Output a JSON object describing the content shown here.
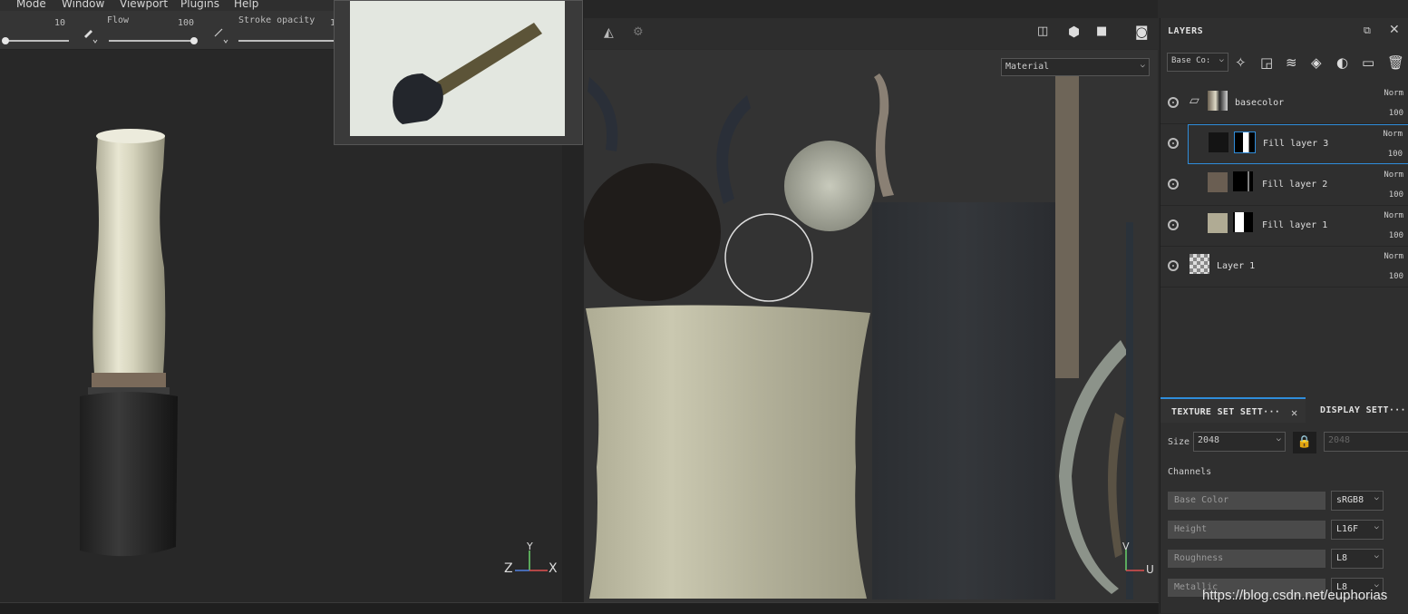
{
  "menubar": {
    "items": [
      "Mode",
      "Window",
      "Viewport",
      "Plugins",
      "Help"
    ]
  },
  "toolbar": {
    "size_value": "10",
    "flow_label": "Flow",
    "flow_value": "100",
    "stroke_opacity_label": "Stroke opacity",
    "stroke_opacity_value": "1"
  },
  "viewport2d": {
    "channel_select": "Material"
  },
  "axes": {
    "left": {
      "x": "X",
      "y": "Y",
      "z": "Z"
    },
    "right": {
      "v": "V",
      "u": "U"
    }
  },
  "layers": {
    "title": "LAYERS",
    "channel_select": "Base Co:",
    "items": [
      {
        "name": "basecolor",
        "blend": "Norm",
        "opacity": "100",
        "type": "folder"
      },
      {
        "name": "Fill layer 3",
        "blend": "Norm",
        "opacity": "100",
        "type": "fill",
        "selected": true
      },
      {
        "name": "Fill layer 2",
        "blend": "Norm",
        "opacity": "100",
        "type": "fill"
      },
      {
        "name": "Fill layer 1",
        "blend": "Norm",
        "opacity": "100",
        "type": "fill"
      },
      {
        "name": "Layer 1",
        "blend": "Norm",
        "opacity": "100",
        "type": "paint"
      }
    ]
  },
  "texture_set": {
    "tab_active": "TEXTURE SET SETT···",
    "tab_other": "DISPLAY SETT···",
    "size_label": "Size",
    "size_value": "2048",
    "size_value2": "2048",
    "channels_label": "Channels",
    "channels": [
      {
        "name": "Base Color",
        "format": "sRGB8"
      },
      {
        "name": "Height",
        "format": "L16F"
      },
      {
        "name": "Roughness",
        "format": "L8"
      },
      {
        "name": "Metallic",
        "format": "L8"
      }
    ]
  },
  "watermark": "https://blog.csdn.net/euphorias",
  "colors": {
    "accent": "#2f8ddb",
    "panel_bg": "#2f2f2f",
    "viewport_bg": "#282828"
  }
}
